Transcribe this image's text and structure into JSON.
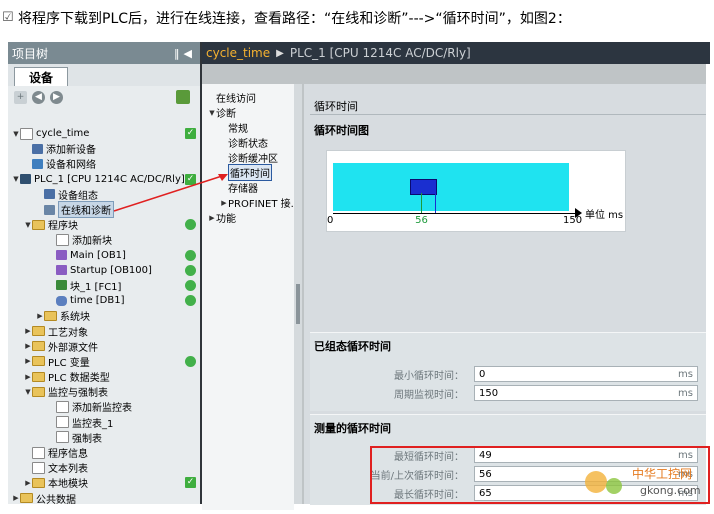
{
  "caption": "将程序下载到PLC后，进行在线连接，查看路径：“在线和诊断”--->“循环时间”，如图2：",
  "tree": {
    "title": "项目树",
    "tab": "设备",
    "items": [
      {
        "label": "cycle_time",
        "indent": 0,
        "tw": "▼",
        "icon": "page",
        "status": "chk"
      },
      {
        "label": "添加新设备",
        "indent": 1,
        "tw": "",
        "icon": "dev",
        "status": ""
      },
      {
        "label": "设备和网络",
        "indent": 1,
        "tw": "",
        "icon": "net",
        "status": ""
      },
      {
        "label": "PLC_1 [CPU 1214C AC/DC/Rly]",
        "indent": 0,
        "tw": "▼",
        "icon": "plc",
        "status": "chk"
      },
      {
        "label": "设备组态",
        "indent": 2,
        "tw": "",
        "icon": "dev",
        "status": ""
      },
      {
        "label": "在线和诊断",
        "indent": 2,
        "tw": "",
        "icon": "diag",
        "status": "",
        "sel": true
      },
      {
        "label": "程序块",
        "indent": 1,
        "tw": "▼",
        "icon": "folder",
        "status": "dot"
      },
      {
        "label": "添加新块",
        "indent": 3,
        "tw": "",
        "icon": "page",
        "status": ""
      },
      {
        "label": "Main [OB1]",
        "indent": 3,
        "tw": "",
        "icon": "ob",
        "status": "dot"
      },
      {
        "label": "Startup [OB100]",
        "indent": 3,
        "tw": "",
        "icon": "ob",
        "status": "dot"
      },
      {
        "label": "块_1 [FC1]",
        "indent": 3,
        "tw": "",
        "icon": "fc",
        "status": "dot"
      },
      {
        "label": "time [DB1]",
        "indent": 3,
        "tw": "",
        "icon": "db",
        "status": "dot"
      },
      {
        "label": "系统块",
        "indent": 2,
        "tw": "▶",
        "icon": "folder",
        "status": ""
      },
      {
        "label": "工艺对象",
        "indent": 1,
        "tw": "▶",
        "icon": "folder",
        "status": ""
      },
      {
        "label": "外部源文件",
        "indent": 1,
        "tw": "▶",
        "icon": "folder",
        "status": ""
      },
      {
        "label": "PLC 变量",
        "indent": 1,
        "tw": "▶",
        "icon": "folder",
        "status": "dot"
      },
      {
        "label": "PLC 数据类型",
        "indent": 1,
        "tw": "▶",
        "icon": "folder",
        "status": ""
      },
      {
        "label": "监控与强制表",
        "indent": 1,
        "tw": "▼",
        "icon": "folder",
        "status": ""
      },
      {
        "label": "添加新监控表",
        "indent": 3,
        "tw": "",
        "icon": "page",
        "status": ""
      },
      {
        "label": "监控表_1",
        "indent": 3,
        "tw": "",
        "icon": "page",
        "status": ""
      },
      {
        "label": "强制表",
        "indent": 3,
        "tw": "",
        "icon": "page",
        "status": ""
      },
      {
        "label": "程序信息",
        "indent": 1,
        "tw": "",
        "icon": "page",
        "status": ""
      },
      {
        "label": "文本列表",
        "indent": 1,
        "tw": "",
        "icon": "page",
        "status": ""
      },
      {
        "label": "本地模块",
        "indent": 1,
        "tw": "▶",
        "icon": "folder",
        "status": "chk"
      },
      {
        "label": "公共数据",
        "indent": 0,
        "tw": "▶",
        "icon": "folder",
        "status": ""
      }
    ]
  },
  "breadcrumb": {
    "part1": "cycle_time",
    "part2": "PLC_1 [CPU 1214C AC/DC/Rly]"
  },
  "nav": [
    {
      "label": "在线访问",
      "indent": 0,
      "tw": ""
    },
    {
      "label": "诊断",
      "indent": 0,
      "tw": "▼"
    },
    {
      "label": "常规",
      "indent": 1,
      "tw": ""
    },
    {
      "label": "诊断状态",
      "indent": 1,
      "tw": ""
    },
    {
      "label": "诊断缓冲区",
      "indent": 1,
      "tw": ""
    },
    {
      "label": "循环时间",
      "indent": 1,
      "tw": "",
      "sel": true
    },
    {
      "label": "存储器",
      "indent": 1,
      "tw": ""
    },
    {
      "label": "PROFINET 接...",
      "indent": 1,
      "tw": "▶"
    },
    {
      "label": "功能",
      "indent": 0,
      "tw": "▶"
    }
  ],
  "content": {
    "header": "循环时间",
    "chart_title": "循环时间图",
    "configured_title": "已组态循环时间",
    "measured_title": "测量的循环时间"
  },
  "chart_data": {
    "type": "bar",
    "axis": {
      "min": 0,
      "max": 150,
      "ticks": [
        0,
        56,
        150
      ],
      "unit": "单位 ms"
    },
    "blue_block": {
      "from": 49,
      "to": 65
    },
    "markers": [
      {
        "value": 56,
        "color": "#1c9a3a"
      },
      {
        "value": 65,
        "color": "#1a2fd0"
      }
    ]
  },
  "configured": [
    {
      "label": "最小循环时间：",
      "value": "0",
      "unit": "ms"
    },
    {
      "label": "周期监视时间：",
      "value": "150",
      "unit": "ms"
    }
  ],
  "measured": [
    {
      "label": "最短循环时间：",
      "value": "49",
      "unit": "ms"
    },
    {
      "label": "当前/上次循环时间：",
      "value": "56",
      "unit": "ms"
    },
    {
      "label": "最长循环时间：",
      "value": "65",
      "unit": "ms"
    }
  ],
  "watermark": {
    "text1": "中华工控网",
    "text2": "gkong.com"
  },
  "colors": {
    "red": "#e02020",
    "cyan": "#1fe3f0",
    "accent": "#f5b230"
  }
}
